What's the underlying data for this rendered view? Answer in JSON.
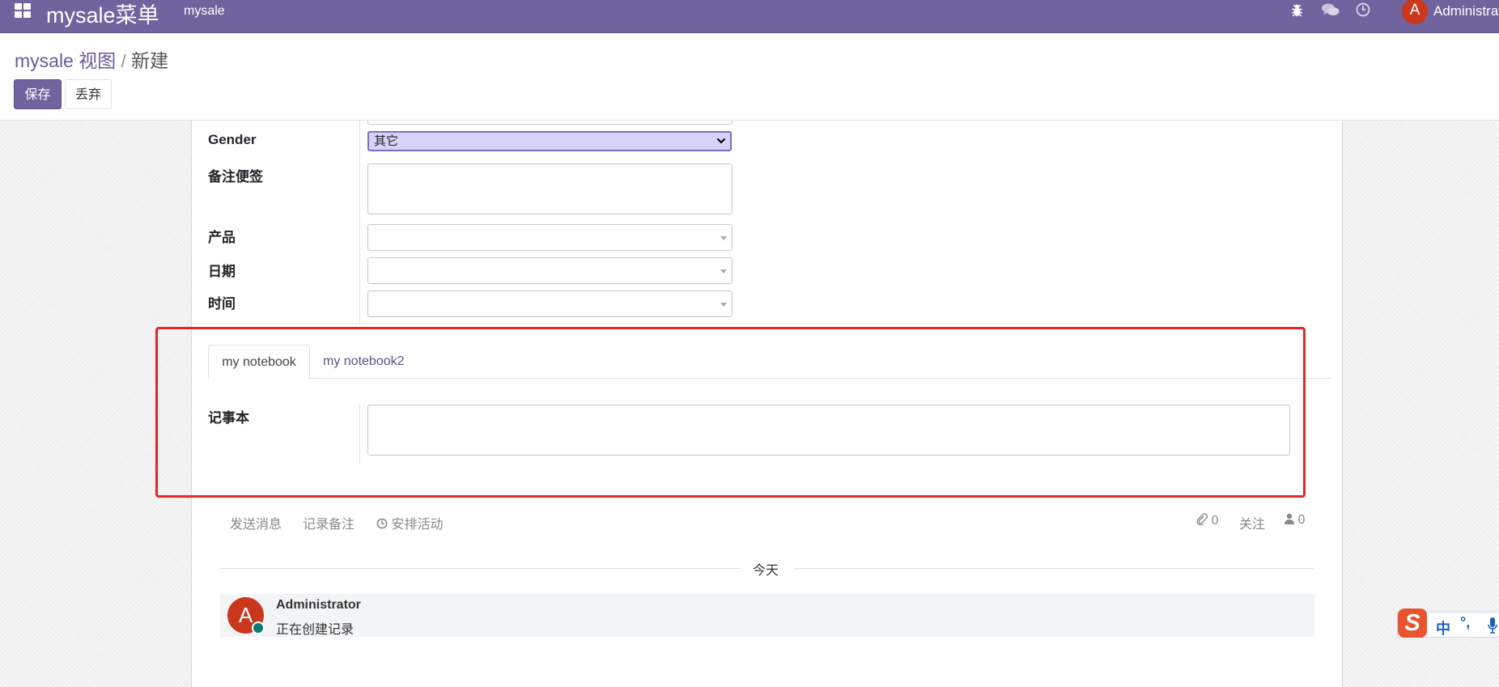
{
  "navbar": {
    "brand": "mysale菜单",
    "menu_item": "mysale",
    "icons": [
      "bug-icon",
      "chat-icon",
      "clock-icon"
    ],
    "user_initial": "A",
    "user_name": "Administrator",
    "avatar_color": "#c9371d",
    "bg_color": "#71639e"
  },
  "breadcrumb": {
    "parent": "mysale 视图",
    "separator": "/",
    "current": "新建"
  },
  "buttons": {
    "save": "保存",
    "discard": "丢弃"
  },
  "form": {
    "gender_label": "Gender",
    "gender_value": "其它",
    "note_label": "备注便签",
    "product_label": "产品",
    "date_label": "日期",
    "time_label": "时间"
  },
  "notebook": {
    "tabs": [
      "my notebook",
      "my notebook2"
    ],
    "active_tab": 0,
    "field_label": "记事本"
  },
  "chatter": {
    "send_message": "发送消息",
    "log_note": "记录备注",
    "schedule_activity": "安排活动",
    "attachments_count": "0",
    "follow": "关注",
    "followers_count": "0",
    "date_separator": "今天",
    "message": {
      "author": "Administrator",
      "avatar_initial": "A",
      "body": "正在创建记录"
    }
  },
  "ime": {
    "logo": "S",
    "mode": "中",
    "punct": "°,"
  },
  "highlight_color": "#e5262a"
}
